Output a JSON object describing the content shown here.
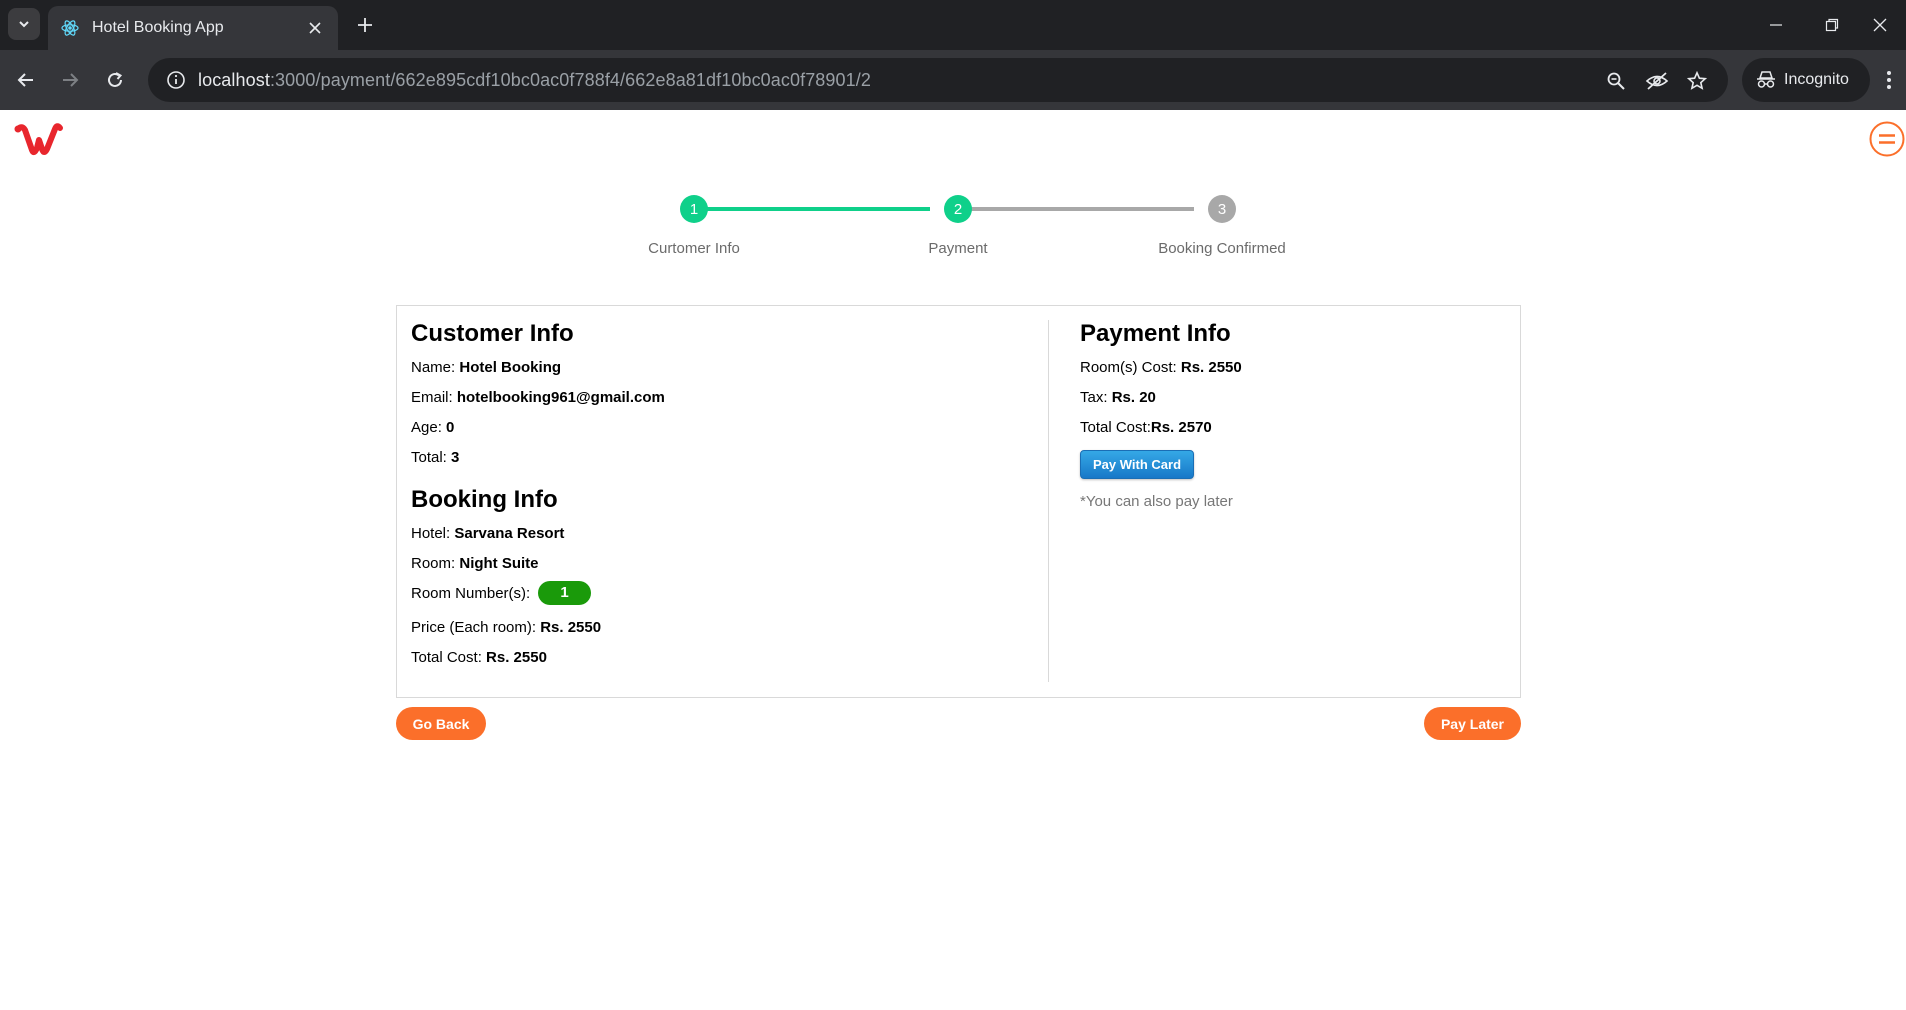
{
  "browser": {
    "tab_title": "Hotel Booking App",
    "url_host": "localhost",
    "url_path": ":3000/payment/662e895cdf10bc0ac0f788f4/662e8a81df10bc0ac0f78901/2",
    "incognito_label": "Incognito"
  },
  "stepper": {
    "steps": [
      {
        "number": "1",
        "label": "Curtomer Info",
        "state": "done"
      },
      {
        "number": "2",
        "label": "Payment",
        "state": "active"
      },
      {
        "number": "3",
        "label": "Booking Confirmed",
        "state": "pending"
      }
    ],
    "colors": {
      "done": "#0fd08a",
      "pending": "#a8a8a8"
    }
  },
  "customer": {
    "heading": "Customer Info",
    "name_label": "Name: ",
    "name": "Hotel Booking",
    "email_label": "Email: ",
    "email": "hotelbooking961@gmail.com",
    "age_label": "Age: ",
    "age": "0",
    "total_label": "Total: ",
    "total": "3"
  },
  "booking": {
    "heading": "Booking Info",
    "hotel_label": "Hotel: ",
    "hotel": "Sarvana Resort",
    "room_label": "Room: ",
    "room": "Night Suite",
    "room_numbers_label": "Room Number(s): ",
    "room_numbers": [
      "1"
    ],
    "price_label": "Price (Each room): ",
    "price": "Rs. 2550",
    "total_cost_label": "Total Cost: ",
    "total_cost": "Rs. 2550"
  },
  "payment": {
    "heading": "Payment Info",
    "rooms_cost_label": "Room(s) Cost: ",
    "rooms_cost": "Rs. 2550",
    "tax_label": "Tax: ",
    "tax": "Rs. 20",
    "total_cost_label": "Total Cost:",
    "total_cost": "Rs. 2570",
    "pay_card_label": "Pay With Card",
    "note": "*You can also pay later"
  },
  "actions": {
    "go_back": "Go Back",
    "pay_later": "Pay Later"
  },
  "colors": {
    "brand_red": "#e8262d",
    "orange": "#fb6f2a",
    "room_pill": "#1a9a0a",
    "pay_card": "#1f8ad6"
  }
}
